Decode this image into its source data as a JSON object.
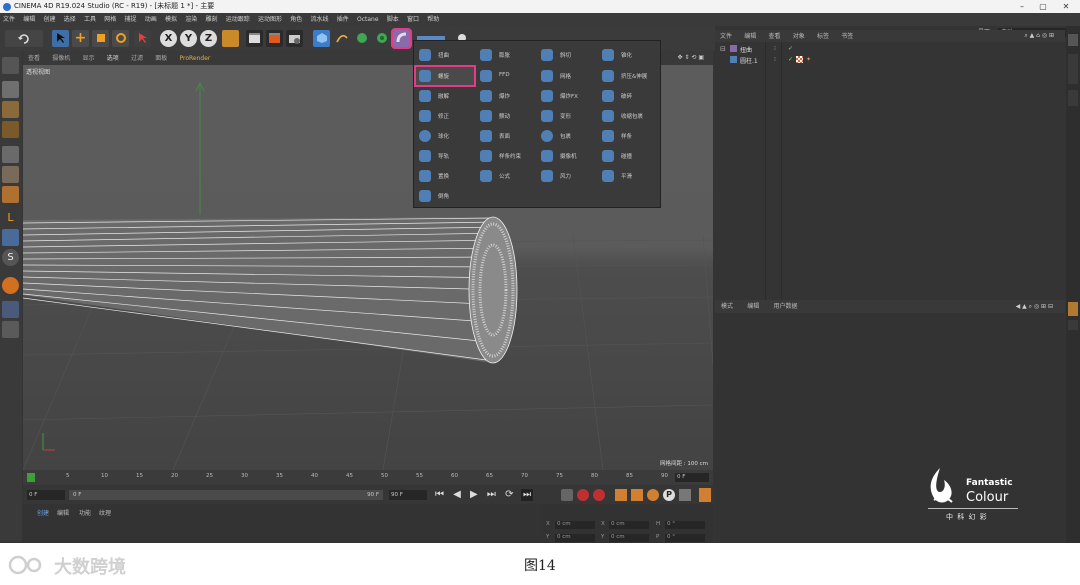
{
  "window": {
    "title": "CINEMA 4D R19.024 Studio (RC - R19) - [未标题 1 *] - 主要",
    "minimize": "–",
    "maximize": "▢",
    "close": "✕"
  },
  "menu": [
    "文件",
    "编辑",
    "创建",
    "选择",
    "工具",
    "网格",
    "捕捉",
    "动画",
    "模拟",
    "渲染",
    "雕刻",
    "运动跟踪",
    "运动图形",
    "角色",
    "流水线",
    "插件",
    "Octane",
    "脚本",
    "窗口",
    "帮助"
  ],
  "layout": {
    "label": "界面",
    "value": "启动"
  },
  "toolbar": {
    "x": "X",
    "y": "Y",
    "z": "Z"
  },
  "viewport": {
    "menu": [
      "查看",
      "摄像机",
      "显示",
      "选项",
      "过滤",
      "面板",
      "ProRender"
    ],
    "camera_label": "透视视图",
    "grid_info": "网格间距 : 100 cm"
  },
  "deformers": [
    [
      "扭曲",
      "膨胀",
      "斜切",
      "锥化"
    ],
    [
      "螺旋",
      "FFD",
      "网格",
      "挤压&伸展"
    ],
    [
      "融解",
      "爆炸",
      "爆炸FX",
      "破碎"
    ],
    [
      "修正",
      "颤动",
      "变形",
      "收缩包裹"
    ],
    [
      "球化",
      "表面",
      "包裹",
      "样条"
    ],
    [
      "导轨",
      "样条约束",
      "摄像机",
      "碰撞"
    ],
    [
      "置换",
      "公式",
      "风力",
      "平滑"
    ],
    [
      "倒角"
    ]
  ],
  "object_manager": {
    "menu": [
      "文件",
      "编辑",
      "查看",
      "对象",
      "标签",
      "书签"
    ],
    "items": [
      "扭曲",
      "圆柱.1"
    ]
  },
  "attribute_manager": {
    "menu": [
      "模式",
      "编辑",
      "用户数据"
    ]
  },
  "right_tabs": [
    "对象",
    "内容浏览器",
    "构造",
    "属性",
    "层"
  ],
  "timeline": {
    "ticks": [
      "0",
      "5",
      "10",
      "15",
      "20",
      "25",
      "30",
      "35",
      "40",
      "45",
      "50",
      "55",
      "60",
      "65",
      "70",
      "75",
      "80",
      "85",
      "90"
    ],
    "end_field": "0 F",
    "start": "0 F",
    "current": "0 F",
    "end": "90 F",
    "max": "90 F"
  },
  "materials": {
    "tabs": [
      "创建",
      "编辑",
      "功能",
      "纹理"
    ]
  },
  "coords": {
    "labels": [
      "X",
      "Y",
      "Z",
      "X",
      "Y",
      "Z",
      "H",
      "P",
      "B"
    ],
    "pos": "0 cm",
    "rot": "0 °"
  },
  "brand": {
    "name1": "Fantastic",
    "name2": "Colour",
    "cn": "中 科 幻 彩"
  },
  "watermark": "大数跨境",
  "caption": "图14",
  "colors": {
    "highlight": "#e5398a",
    "accent": "#4f7fb4"
  }
}
